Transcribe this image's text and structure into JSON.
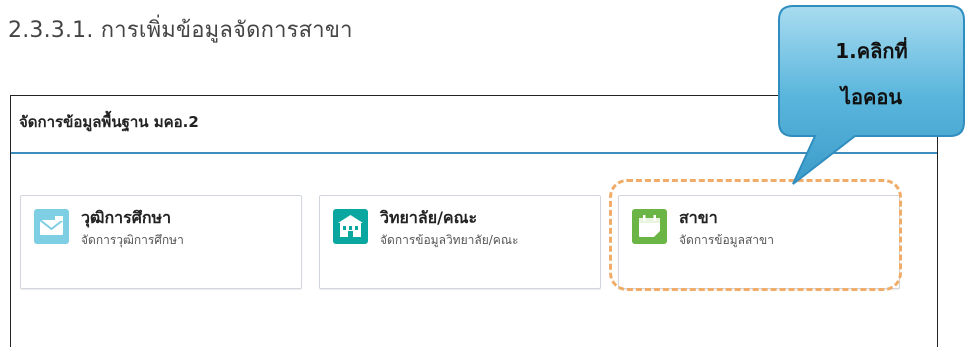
{
  "heading": "2.3.3.1. การเพิ่มข้อมูลจัดการสาขา",
  "panel": {
    "title": "จัดการข้อมูลพื้นฐาน มคอ.2"
  },
  "cards": [
    {
      "title": "วุฒิการศึกษา",
      "subtitle": "จัดการวุฒิการศึกษา",
      "icon": "envelope-icon",
      "color": "#7ecfe3"
    },
    {
      "title": "วิทยาลัย/คณะ",
      "subtitle": "จัดการข้อมูลวิทยาลัย/คณะ",
      "icon": "building-icon",
      "color": "#0aa6a0"
    },
    {
      "title": "สาขา",
      "subtitle": "จัดการข้อมูลสาขา",
      "icon": "calendar-icon",
      "color": "#6ab545"
    }
  ],
  "callout": {
    "line1": "1.คลิกที่",
    "line2": "ไอคอน"
  },
  "colors": {
    "accent_rule": "#3c8dbc",
    "highlight": "#f0ad6a",
    "callout_fill": "#5bb6dd"
  }
}
